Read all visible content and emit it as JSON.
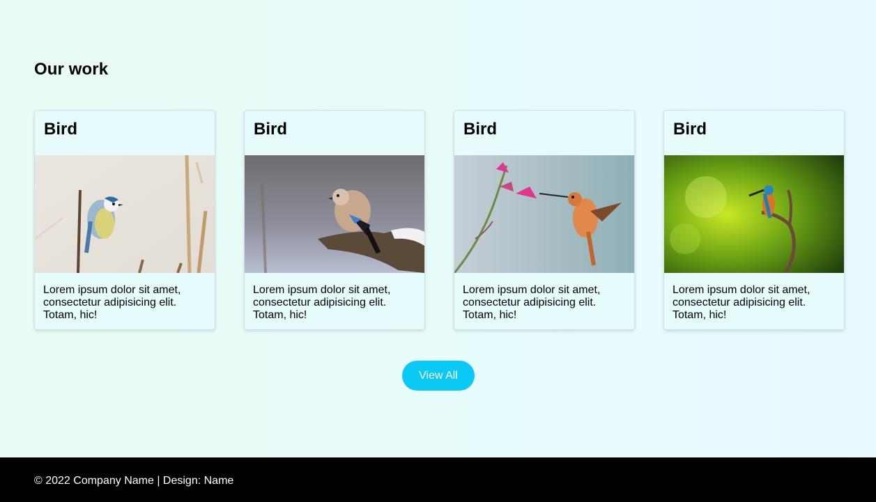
{
  "section": {
    "title": "Our work"
  },
  "cards": [
    {
      "title": "Bird",
      "text": "Lorem ipsum dolor sit amet, consectetur adipisicing elit. Totam, hic!",
      "image": "blue-tit-bird"
    },
    {
      "title": "Bird",
      "text": "Lorem ipsum dolor sit amet, consectetur adipisicing elit. Totam, hic!",
      "image": "jay-bird"
    },
    {
      "title": "Bird",
      "text": "Lorem ipsum dolor sit amet, consectetur adipisicing elit. Totam, hic!",
      "image": "hummingbird"
    },
    {
      "title": "Bird",
      "text": "Lorem ipsum dolor sit amet, consectetur adipisicing elit. Totam, hic!",
      "image": "kingfisher-bird"
    }
  ],
  "view_all": {
    "label": "View All"
  },
  "footer": {
    "text": "© 2022 Company Name | Design: Name"
  },
  "colors": {
    "accent": "#0acaf5",
    "footer_bg": "#000000",
    "page_bg": "#e6fbfb"
  }
}
